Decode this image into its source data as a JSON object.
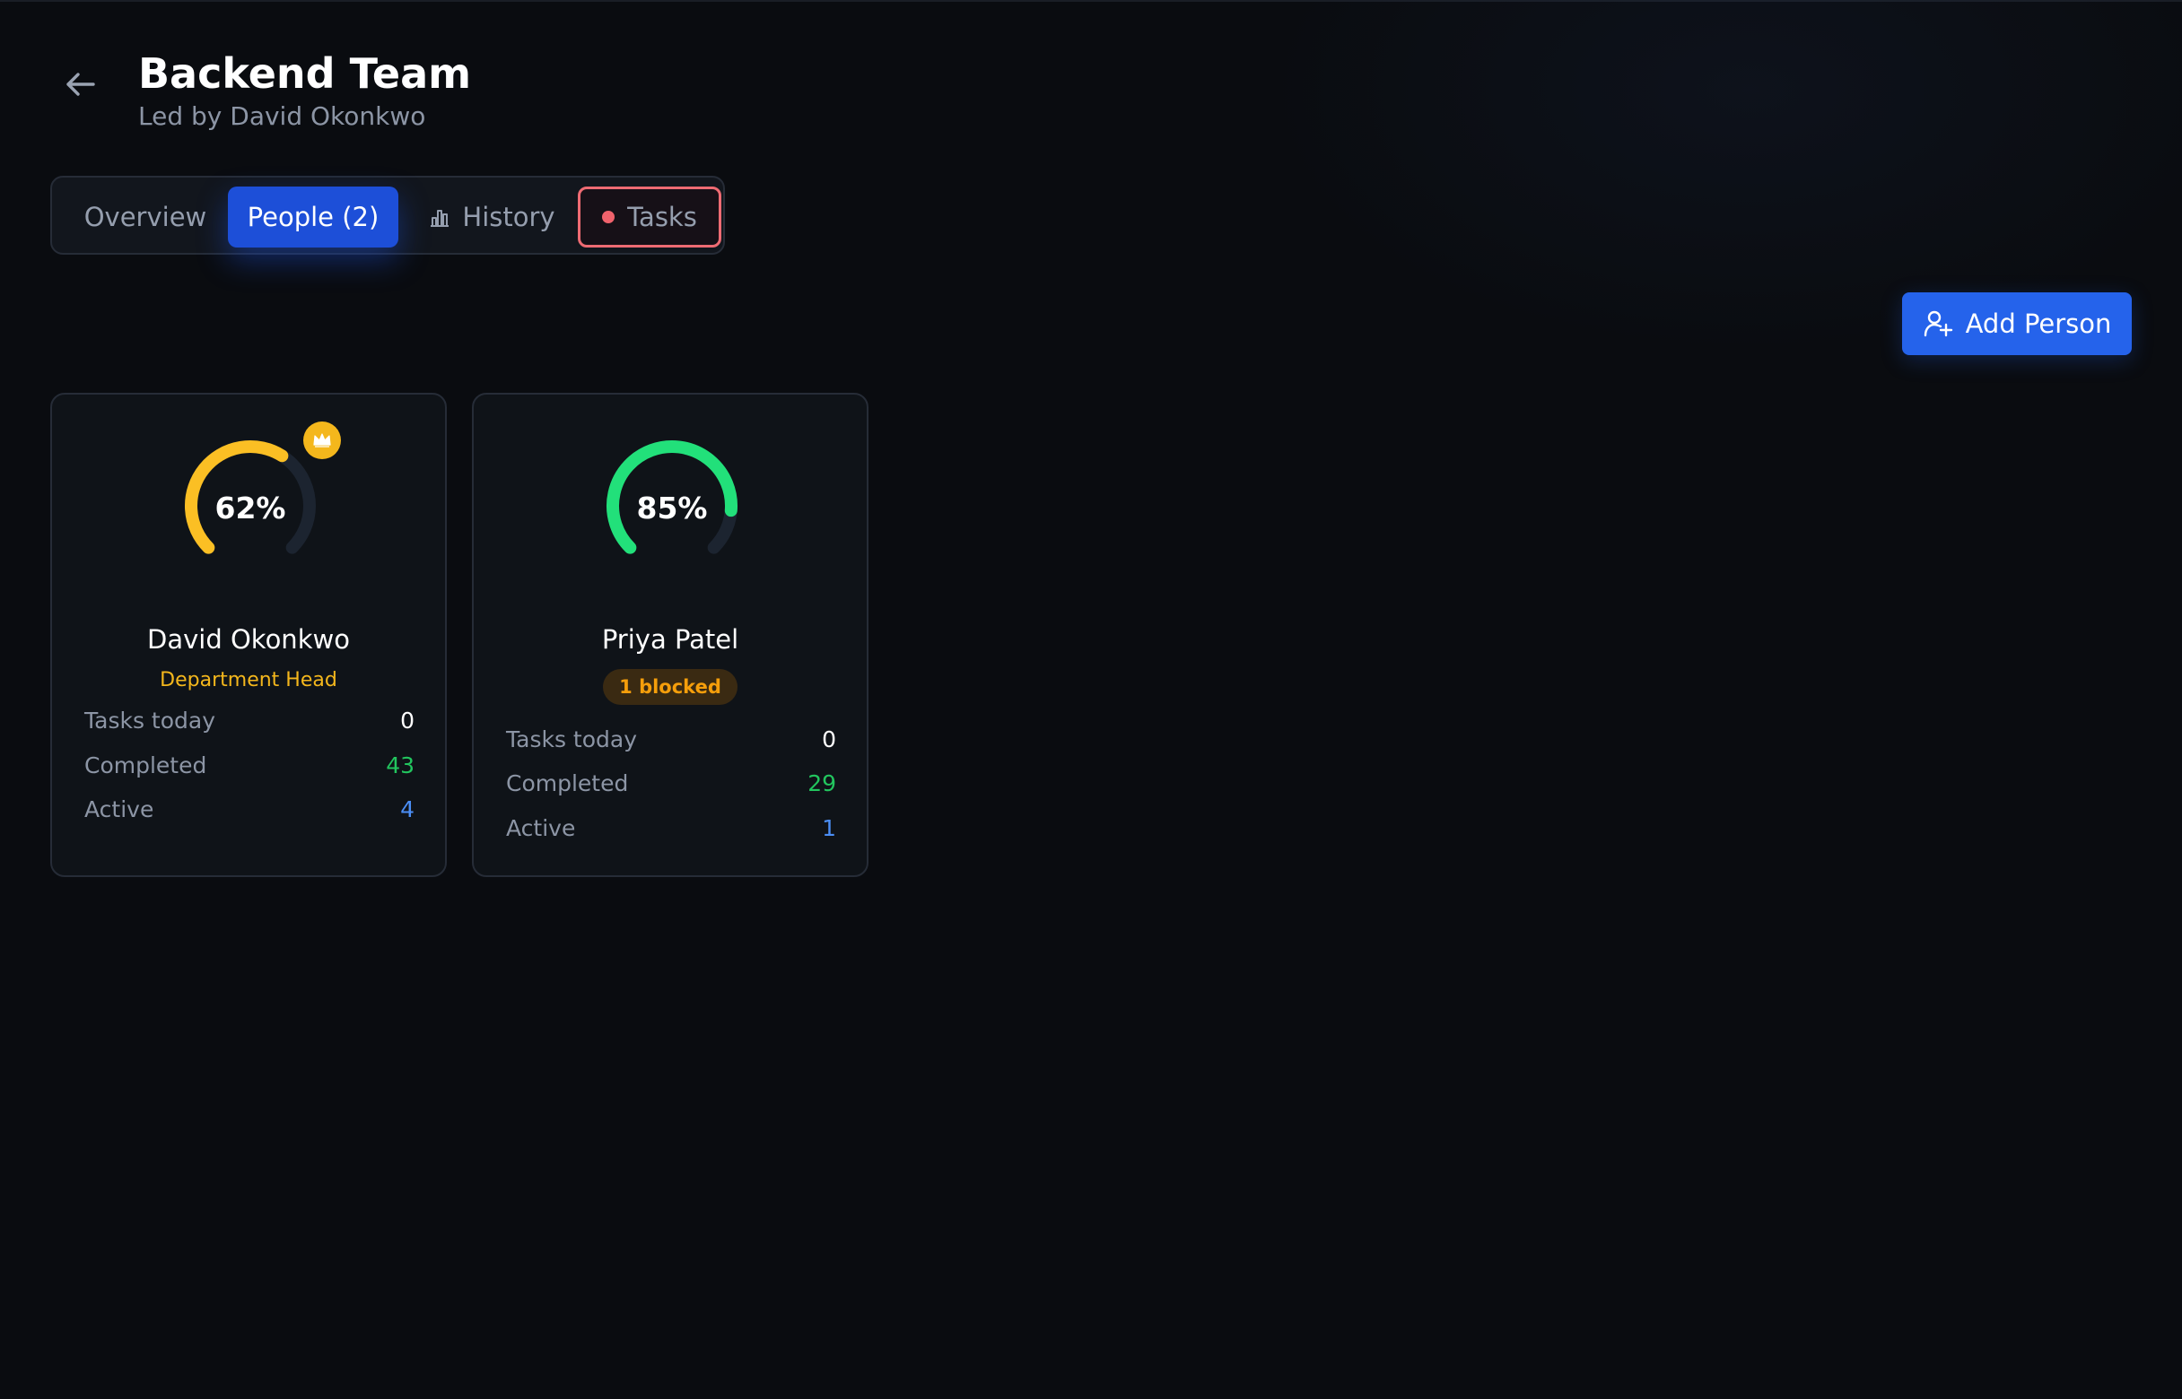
{
  "header": {
    "title": "Backend Team",
    "subtitle": "Led by David Okonkwo"
  },
  "tabs": [
    {
      "label": "Overview",
      "active": false
    },
    {
      "label": "People (2)",
      "active": true
    },
    {
      "label": "History",
      "icon": "bar-chart-icon",
      "active": false
    },
    {
      "label": "Tasks",
      "icon": "alert-dot-icon",
      "highlighted": true
    }
  ],
  "actions": {
    "add_person_label": "Add Person",
    "add_person_icon": "user-plus-icon"
  },
  "people": [
    {
      "name": "David Okonkwo",
      "score_percent": 62,
      "score_label": "62%",
      "gauge_color": "#fbbf24",
      "role": "Department Head",
      "role_icon": "crown-icon",
      "stats": [
        {
          "label": "Tasks today",
          "value": "0"
        },
        {
          "label": "Completed",
          "value": "43"
        },
        {
          "label": "Active",
          "value": "4"
        }
      ]
    },
    {
      "name": "Priya Patel",
      "score_percent": 85,
      "score_label": "85%",
      "gauge_color": "#22e07a",
      "badge": "1 blocked",
      "stats": [
        {
          "label": "Tasks today",
          "value": "0"
        },
        {
          "label": "Completed",
          "value": "29"
        },
        {
          "label": "Active",
          "value": "1"
        }
      ]
    }
  ],
  "colors": {
    "background": "#0a0c10",
    "accent": "#2563eb",
    "tab_active": "#1d4fd8",
    "alert": "#ee6b73",
    "completed": "#22c55e",
    "active": "#4b8ef5",
    "head": "#f4b71c",
    "blocked": "#f59e0b"
  }
}
